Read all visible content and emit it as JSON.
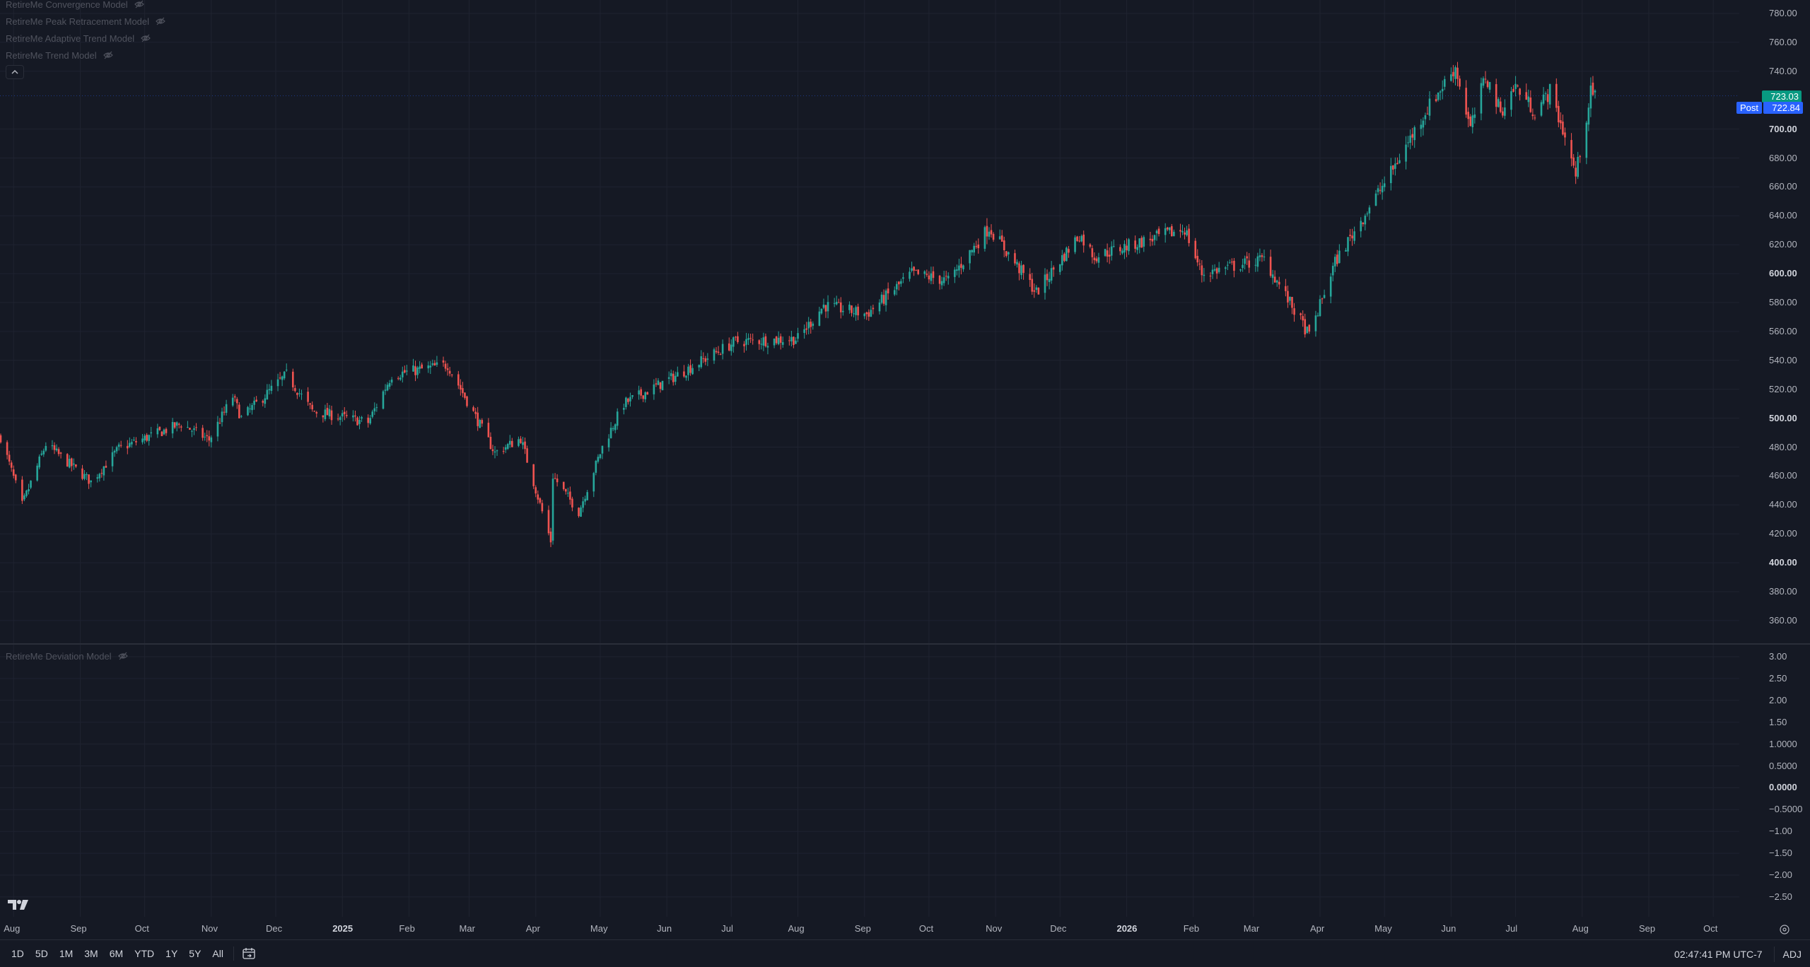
{
  "legend": {
    "indicators": [
      {
        "name": "RetireMe Convergence Model"
      },
      {
        "name": "RetireMe Peak Retracement Model"
      },
      {
        "name": "RetireMe Adaptive Trend Model"
      },
      {
        "name": "RetireMe Trend Model"
      }
    ],
    "sub_indicator": "RetireMe Deviation Model"
  },
  "price_tags": {
    "last": "723.03",
    "post_label": "Post",
    "post_value": "722.84"
  },
  "price_axis": {
    "labels": [
      "780.00",
      "760.00",
      "740.00",
      "700.00",
      "680.00",
      "660.00",
      "640.00",
      "620.00",
      "600.00",
      "580.00",
      "560.00",
      "540.00",
      "520.00",
      "500.00",
      "480.00",
      "460.00",
      "440.00",
      "420.00",
      "400.00",
      "380.00",
      "360.00"
    ],
    "bold": [
      "700.00",
      "600.00",
      "500.00",
      "400.00"
    ]
  },
  "sub_axis": {
    "labels": [
      "3.00",
      "2.50",
      "2.00",
      "1.50",
      "1.0000",
      "0.5000",
      "0.0000",
      "−0.5000",
      "−1.00",
      "−1.50",
      "−2.00",
      "−2.50"
    ],
    "bold": [
      "0.0000"
    ]
  },
  "time_axis": {
    "labels": [
      "Aug",
      "Sep",
      "Oct",
      "Nov",
      "Dec",
      "2025",
      "Feb",
      "Mar",
      "Apr",
      "May",
      "Jun",
      "Jul",
      "Aug",
      "Sep",
      "Oct",
      "Nov",
      "Dec",
      "2026",
      "Feb",
      "Mar",
      "Apr",
      "May",
      "Jun",
      "Jul",
      "Aug",
      "Sep",
      "Oct"
    ],
    "bold": [
      "2025",
      "2026"
    ]
  },
  "toolbar": {
    "ranges": [
      "1D",
      "5D",
      "1M",
      "3M",
      "6M",
      "YTD",
      "1Y",
      "5Y",
      "All"
    ],
    "clock": "02:47:41 PM UTC-7",
    "adj": "ADJ"
  },
  "colors": {
    "background": "#151924",
    "grid": "#1f2330",
    "up": "#26a69a",
    "down": "#ef5350",
    "last_tag": "#089981",
    "post_tag": "#2962ff"
  },
  "chart_data": {
    "type": "candlestick",
    "ylim": [
      345,
      790
    ],
    "anchors": [
      {
        "date": "2024-07-26",
        "close": 487
      },
      {
        "date": "2024-08-05",
        "close": 440
      },
      {
        "date": "2024-08-16",
        "close": 482
      },
      {
        "date": "2024-09-06",
        "close": 456
      },
      {
        "date": "2024-09-19",
        "close": 479
      },
      {
        "date": "2024-10-18",
        "close": 496
      },
      {
        "date": "2024-10-31",
        "close": 485
      },
      {
        "date": "2024-11-11",
        "close": 515
      },
      {
        "date": "2024-11-15",
        "close": 500
      },
      {
        "date": "2024-12-06",
        "close": 530
      },
      {
        "date": "2024-12-18",
        "close": 505
      },
      {
        "date": "2025-01-13",
        "close": 497
      },
      {
        "date": "2025-01-24",
        "close": 530
      },
      {
        "date": "2025-02-19",
        "close": 537
      },
      {
        "date": "2025-03-13",
        "close": 476
      },
      {
        "date": "2025-03-25",
        "close": 486
      },
      {
        "date": "2025-04-08",
        "close": 415
      },
      {
        "date": "2025-04-09",
        "close": 460
      },
      {
        "date": "2025-04-21",
        "close": 435
      },
      {
        "date": "2025-05-02",
        "close": 480
      },
      {
        "date": "2025-05-12",
        "close": 510
      },
      {
        "date": "2025-06-06",
        "close": 530
      },
      {
        "date": "2025-07-03",
        "close": 553
      },
      {
        "date": "2025-08-01",
        "close": 555
      },
      {
        "date": "2025-08-13",
        "close": 578
      },
      {
        "date": "2025-09-02",
        "close": 572
      },
      {
        "date": "2025-09-23",
        "close": 600
      },
      {
        "date": "2025-10-10",
        "close": 595
      },
      {
        "date": "2025-10-29",
        "close": 632
      },
      {
        "date": "2025-11-20",
        "close": 587
      },
      {
        "date": "2025-12-10",
        "close": 627
      },
      {
        "date": "2025-12-17",
        "close": 612
      },
      {
        "date": "2026-01-28",
        "close": 631
      },
      {
        "date": "2026-02-05",
        "close": 600
      },
      {
        "date": "2026-03-06",
        "close": 610
      },
      {
        "date": "2026-03-27",
        "close": 557
      },
      {
        "date": "2026-04-08",
        "close": 608
      },
      {
        "date": "2026-05-04",
        "close": 670
      },
      {
        "date": "2026-05-20",
        "close": 712
      },
      {
        "date": "2026-06-03",
        "close": 743
      },
      {
        "date": "2026-06-10",
        "close": 700
      },
      {
        "date": "2026-06-17",
        "close": 737
      },
      {
        "date": "2026-06-24",
        "close": 712
      },
      {
        "date": "2026-07-01",
        "close": 730
      },
      {
        "date": "2026-07-10",
        "close": 712
      },
      {
        "date": "2026-07-17",
        "close": 726
      },
      {
        "date": "2026-07-24",
        "close": 695
      },
      {
        "date": "2026-07-29",
        "close": 668
      },
      {
        "date": "2026-08-05",
        "close": 725
      },
      {
        "date": "2026-08-07",
        "close": 723
      }
    ]
  }
}
